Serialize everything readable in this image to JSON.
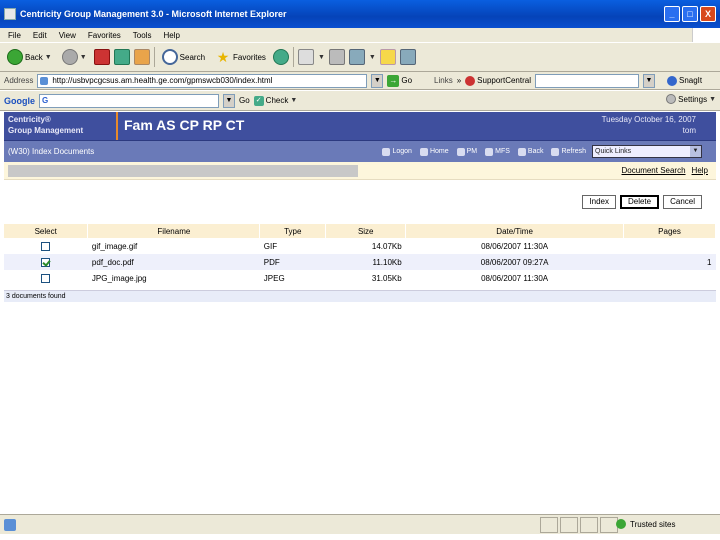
{
  "window": {
    "title": "Centricity Group Management 3.0 - Microsoft Internet Explorer",
    "minimize": "_",
    "maximize": "□",
    "close": "X"
  },
  "menu": [
    "File",
    "Edit",
    "View",
    "Favorites",
    "Tools",
    "Help"
  ],
  "toolbar": {
    "back": "Back",
    "search": "Search",
    "favorites": "Favorites"
  },
  "address": {
    "label": "Address",
    "url": "http://usbvpcgcsus.am.health.ge.com/gpmswcb030/index.html",
    "go": "Go",
    "links": "Links",
    "links_more": "»",
    "support": "SupportCentral",
    "snagit": "SnagIt"
  },
  "google": {
    "logo": "Google",
    "go": "Go",
    "check": "Check",
    "settings": "Settings"
  },
  "app": {
    "brand_line1": "Centricity®",
    "brand_line2": "Group Management",
    "patient": "Fam AS CP RP CT",
    "date": "Tuesday October 16, 2007",
    "user": "tom"
  },
  "nav": {
    "title": "(W30) Index Documents",
    "items": [
      "Logon",
      "Home",
      "PM",
      "MFS",
      "Back",
      "Refresh"
    ],
    "quick_links": "Quick Links"
  },
  "links": {
    "document_search": "Document Search",
    "help": "Help"
  },
  "actions": [
    "Index",
    "Delete",
    "Cancel"
  ],
  "table": {
    "headers": [
      "Select",
      "Filename",
      "Type",
      "Size",
      "Date/Time",
      "Pages"
    ],
    "rows": [
      {
        "checked": false,
        "filename": "gif_image.gif",
        "type": "GIF",
        "size": "14.07Kb",
        "datetime": "08/06/2007 11:30A",
        "pages": ""
      },
      {
        "checked": true,
        "filename": "pdf_doc.pdf",
        "type": "PDF",
        "size": "11.10Kb",
        "datetime": "08/06/2007 09:27A",
        "pages": "1"
      },
      {
        "checked": false,
        "filename": "JPG_image.jpg",
        "type": "JPEG",
        "size": "31.05Kb",
        "datetime": "08/06/2007 11:30A",
        "pages": ""
      }
    ],
    "found": "3 documents found"
  },
  "status": {
    "zone": "Trusted sites"
  },
  "colors": {
    "header_bg": "#3f4f9e",
    "nav_bg": "#6a7ab8",
    "table_header_bg": "#fbefd2",
    "accent_divider": "#e88a2a"
  }
}
